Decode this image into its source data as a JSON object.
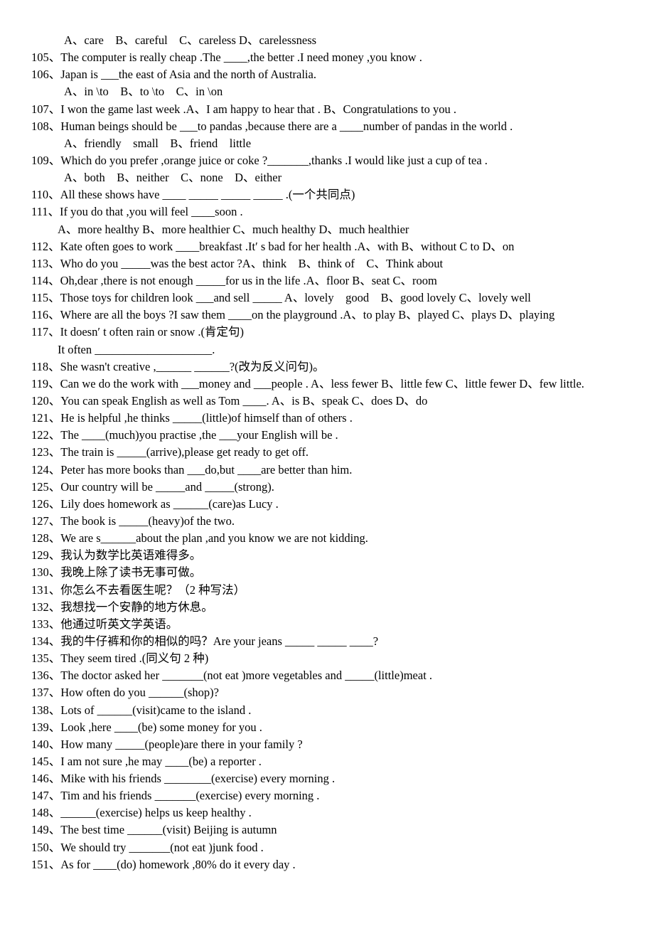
{
  "document": {
    "lines": [
      {
        "num": "",
        "text": "A、care    B、careful    C、careless D、carelessness",
        "indent": "ind1"
      },
      {
        "num": "105、",
        "text": "The computer is really cheap .The ____,the better .I need money ,you know ."
      },
      {
        "num": "106、",
        "text": "Japan is ___the east of Asia and the north of Australia."
      },
      {
        "num": "",
        "text": "A、in \\to    B、to \\to    C、in \\on",
        "indent": "ind1"
      },
      {
        "num": "107、",
        "text": "I won the game last week .A、I am happy to hear that . B、Congratulations to you ."
      },
      {
        "num": "108、",
        "text": "Human beings should be ___to pandas ,because there are a ____number of pandas in the world ."
      },
      {
        "num": "",
        "text": "A、friendly    small    B、friend    little",
        "indent": "ind1"
      },
      {
        "num": "109、",
        "text": "Which do you prefer ,orange juice or coke ?_______,thanks .I would like just a cup of tea ."
      },
      {
        "num": "",
        "text": "A、both    B、neither    C、none    D、either",
        "indent": "ind1"
      },
      {
        "num": "110、",
        "text": "All these shows have ____ _____ _____ _____ .(一个共同点)"
      },
      {
        "num": "111、",
        "text": "If you do that ,you will feel ____soon ."
      },
      {
        "num": "",
        "text": "A、more healthy B、more healthier C、much healthy D、much healthier",
        "indent": "ind2"
      },
      {
        "num": "112、",
        "text": "Kate often goes to work ____breakfast .It′ s bad for her health .A、with B、without C to D、on"
      },
      {
        "num": "113、",
        "text": "Who do you _____was the best actor ?A、think    B、think of    C、Think about"
      },
      {
        "num": "114、",
        "text": "Oh,dear ,there is not enough _____for us in the life .A、floor B、seat C、room"
      },
      {
        "num": "115、",
        "text": "Those toys for children look ___and sell _____ A、lovely    good    B、good lovely C、lovely well"
      },
      {
        "num": "116、",
        "text": "Where are all the boys ?I saw them ____on the playground .A、to play B、played C、plays D、playing"
      },
      {
        "num": "117、",
        "text": "It doesn′ t often rain or snow .(肯定句)"
      },
      {
        "num": "",
        "text": "It often ____________________.",
        "indent": "ind3"
      },
      {
        "num": "118、",
        "text": "She wasn't creative ,______ ______?(改为反义问句)。"
      },
      {
        "num": "119、",
        "text": "Can we do the work with ___money and ___people . A、less fewer B、little few C、little fewer D、few little.",
        "wrap": true
      },
      {
        "num": "120、",
        "text": "You can speak English as well as Tom ____. A、is B、speak C、does D、do"
      },
      {
        "num": "121、",
        "text": "He is helpful ,he thinks _____(little)of himself than of others ."
      },
      {
        "num": "122、",
        "text": "The ____(much)you practise ,the ___your English will be ."
      },
      {
        "num": "123、",
        "text": "The train is _____(arrive),please get ready to get off."
      },
      {
        "num": "124、",
        "text": "Peter has more books than ___do,but ____are better than him."
      },
      {
        "num": "125、",
        "text": "Our country will be _____and _____(strong)."
      },
      {
        "num": "126、",
        "text": "Lily does homework as ______(care)as Lucy ."
      },
      {
        "num": "127、",
        "text": "The book is _____(heavy)of the two."
      },
      {
        "num": "128、",
        "text": "We are s______about the plan ,and you know we are not kidding."
      },
      {
        "num": "129、",
        "text": "我认为数学比英语难得多。"
      },
      {
        "num": "130、",
        "text": "我晚上除了读书无事可做。"
      },
      {
        "num": "131、",
        "text": "你怎么不去看医生呢？（2 种写法）"
      },
      {
        "num": "132、",
        "text": "我想找一个安静的地方休息。"
      },
      {
        "num": "133、",
        "text": "他通过听英文学英语。"
      },
      {
        "num": "134、",
        "text": "我的牛仔裤和你的相似的吗？Are your jeans _____ _____ ____?"
      },
      {
        "num": "135、",
        "text": "They seem tired .(同义句 2 种)"
      },
      {
        "num": "136、",
        "text": "The doctor asked her _______(not eat )more vegetables and _____(little)meat ."
      },
      {
        "num": "137、",
        "text": "How often do you ______(shop)?"
      },
      {
        "num": "138、",
        "text": "Lots of ______(visit)came to the island ."
      },
      {
        "num": "139、",
        "text": "Look ,here ____(be) some money for you ."
      },
      {
        "num": "140、",
        "text": "How many _____(people)are there in your family ?"
      },
      {
        "num": "145、",
        "text": "I am not sure ,he may ____(be) a reporter ."
      },
      {
        "num": "146、",
        "text": "Mike with his friends ________(exercise) every morning ."
      },
      {
        "num": "147、",
        "text": "Tim and his friends _______(exercise) every morning ."
      },
      {
        "num": "148、",
        "text": "______(exercise) helps us keep healthy ."
      },
      {
        "num": "149、",
        "text": "The best time ______(visit) Beijing is autumn"
      },
      {
        "num": "150、",
        "text": "We should try _______(not eat )junk food ."
      },
      {
        "num": "151、",
        "text": "As for ____(do) homework ,80% do it every day ."
      }
    ]
  }
}
